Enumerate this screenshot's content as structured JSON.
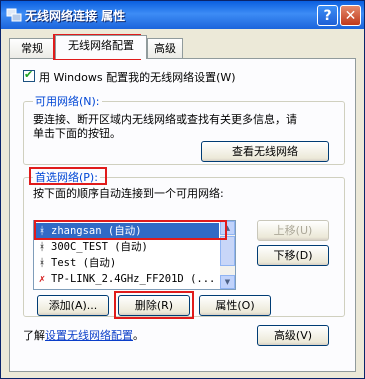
{
  "window": {
    "title": "无线网络连接 属性",
    "help_label": "?",
    "close_label": "✕"
  },
  "tabs": [
    {
      "label": "常规"
    },
    {
      "label": "无线网络配置"
    },
    {
      "label": "高级"
    }
  ],
  "use_windows_checkbox": {
    "label": "用 Windows 配置我的无线网络设置(W)",
    "checked": true
  },
  "available_networks": {
    "legend": "可用网络(N):",
    "description_line1": "要连接、断开区域内无线网络或查找有关更多信息，请",
    "description_line2": "单击下面的按钮。",
    "view_button": "查看无线网络"
  },
  "preferred_networks": {
    "legend": "首选网络(P):",
    "description": "按下面的顺序自动连接到一个可用网络:",
    "items": [
      {
        "label": "zhangsan (自动)",
        "icon": "wireless-antenna-icon",
        "selected": true
      },
      {
        "label": "300C_TEST (自动)",
        "icon": "antenna-icon",
        "selected": false
      },
      {
        "label": "Test (自动)",
        "icon": "antenna-icon",
        "selected": false
      },
      {
        "label": "TP-LINK_2.4GHz_FF201D (...",
        "icon": "antenna-disconnected-icon",
        "selected": false
      }
    ],
    "move_up_button": "上移(U)",
    "move_down_button": "下移(D)",
    "add_button": "添加(A)...",
    "delete_button": "删除(R)",
    "properties_button": "属性(O)"
  },
  "footer": {
    "learn_prefix": "了解",
    "learn_link": "设置无线网络配置",
    "learn_suffix": "。",
    "advanced_button": "高级(V)"
  },
  "colors": {
    "titlebar": "#0a5fe0",
    "highlight_box": "#e01b1b",
    "selection": "#316ac5"
  }
}
